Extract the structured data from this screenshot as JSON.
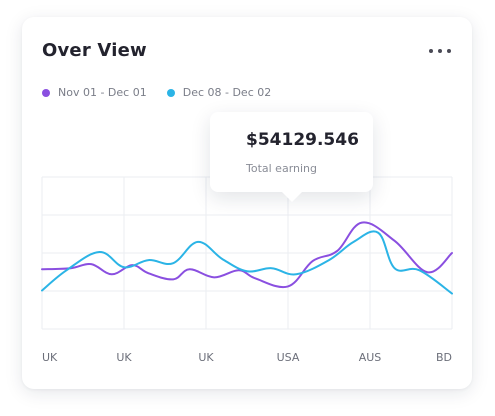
{
  "card": {
    "title": "Over View"
  },
  "tooltip": {
    "value": "$54129.546",
    "label": "Total earning"
  },
  "colors": {
    "series_1": "#8a4fe0",
    "series_2": "#2bb4e6",
    "grid": "#ebedf2"
  },
  "icons": {
    "menu": "more-horizontal-icon"
  },
  "chart_data": {
    "type": "line",
    "title": "Over View",
    "x": [
      "UK",
      "UK",
      "UK",
      "USA",
      "AUS",
      "BD"
    ],
    "series": [
      {
        "name": "Nov 01 - Dec 01",
        "color": "#8a4fe0",
        "values": [
          [
            0,
            59
          ],
          [
            0.35,
            60
          ],
          [
            0.6,
            64
          ],
          [
            0.85,
            54
          ],
          [
            1.1,
            63
          ],
          [
            1.3,
            55
          ],
          [
            1.6,
            49
          ],
          [
            1.8,
            59
          ],
          [
            2.1,
            51
          ],
          [
            2.4,
            58
          ],
          [
            2.6,
            50
          ],
          [
            3.0,
            42
          ],
          [
            3.3,
            67
          ],
          [
            3.6,
            77
          ],
          [
            3.9,
            105
          ],
          [
            4.3,
            87
          ],
          [
            4.7,
            56
          ],
          [
            5.0,
            75
          ]
        ]
      },
      {
        "name": "Dec 08 - Dec 02",
        "color": "#2bb4e6",
        "values": [
          [
            0,
            38
          ],
          [
            0.3,
            58
          ],
          [
            0.7,
            76
          ],
          [
            1.0,
            61
          ],
          [
            1.3,
            68
          ],
          [
            1.6,
            65
          ],
          [
            1.9,
            86
          ],
          [
            2.2,
            69
          ],
          [
            2.5,
            57
          ],
          [
            2.8,
            60
          ],
          [
            3.1,
            54
          ],
          [
            3.5,
            68
          ],
          [
            3.8,
            86
          ],
          [
            4.1,
            95
          ],
          [
            4.3,
            60
          ],
          [
            4.6,
            58
          ],
          [
            5.0,
            35
          ]
        ]
      }
    ],
    "ylim": [
      0,
      150
    ],
    "grid": true,
    "legend_position": "top-left"
  }
}
